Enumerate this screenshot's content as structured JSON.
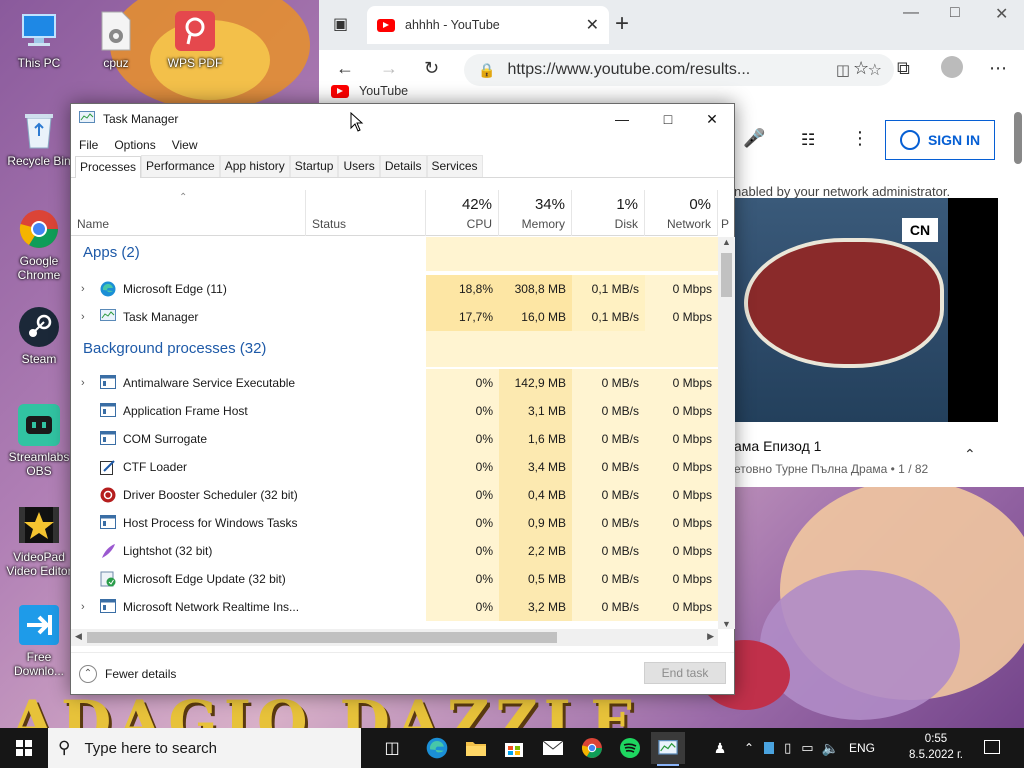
{
  "desktop": {
    "icons": [
      {
        "label": "This PC"
      },
      {
        "label": "cpuz"
      },
      {
        "label": "WPS PDF"
      },
      {
        "label": "Recycle Bin"
      },
      {
        "label": "Google Chrome"
      },
      {
        "label": "Steam"
      },
      {
        "label": "Streamlabs OBS"
      },
      {
        "label": "VideoPad Video Editor"
      },
      {
        "label": "Free Downlo..."
      }
    ],
    "wallpaper_text": "ADAGIO DAZZLE"
  },
  "browser": {
    "tab_title": "ahhhh - YouTube",
    "address": "https://www.youtube.com/results...",
    "favorites_item": "YouTube",
    "sign_in": "SIGN IN",
    "notice_text": "nabled by your network administrator.",
    "channel_logo": "CN",
    "video_title": "ама Епизод 1",
    "video_sub": "етовно Турне Пълна Драма • 1 / 82"
  },
  "task_manager": {
    "title": "Task Manager",
    "menu": [
      "File",
      "Options",
      "View"
    ],
    "tabs": [
      "Processes",
      "Performance",
      "App history",
      "Startup",
      "Users",
      "Details",
      "Services"
    ],
    "active_tab": "Processes",
    "columns": {
      "name": "Name",
      "status": "Status",
      "cpu": {
        "pct": "42%",
        "label": "CPU"
      },
      "memory": {
        "pct": "34%",
        "label": "Memory"
      },
      "disk": {
        "pct": "1%",
        "label": "Disk"
      },
      "network": {
        "pct": "0%",
        "label": "Network"
      },
      "power": "P"
    },
    "groups": {
      "apps": "Apps (2)",
      "background": "Background processes (32)"
    },
    "apps": [
      {
        "name": "Microsoft Edge (11)",
        "cpu": "18,8%",
        "mem": "308,8 MB",
        "disk": "0,1 MB/s",
        "net": "0 Mbps",
        "icon": "edge-icon"
      },
      {
        "name": "Task Manager",
        "cpu": "17,7%",
        "mem": "16,0 MB",
        "disk": "0,1 MB/s",
        "net": "0 Mbps",
        "icon": "taskmanager-icon"
      }
    ],
    "background": [
      {
        "name": "Antimalware Service Executable",
        "cpu": "0%",
        "mem": "142,9 MB",
        "disk": "0 MB/s",
        "net": "0 Mbps",
        "expand": true
      },
      {
        "name": "Application Frame Host",
        "cpu": "0%",
        "mem": "3,1 MB",
        "disk": "0 MB/s",
        "net": "0 Mbps",
        "expand": false
      },
      {
        "name": "COM Surrogate",
        "cpu": "0%",
        "mem": "1,6 MB",
        "disk": "0 MB/s",
        "net": "0 Mbps",
        "expand": false
      },
      {
        "name": "CTF Loader",
        "cpu": "0%",
        "mem": "3,4 MB",
        "disk": "0 MB/s",
        "net": "0 Mbps",
        "expand": false
      },
      {
        "name": "Driver Booster Scheduler (32 bit)",
        "cpu": "0%",
        "mem": "0,4 MB",
        "disk": "0 MB/s",
        "net": "0 Mbps",
        "expand": false
      },
      {
        "name": "Host Process for Windows Tasks",
        "cpu": "0%",
        "mem": "0,9 MB",
        "disk": "0 MB/s",
        "net": "0 Mbps",
        "expand": false
      },
      {
        "name": "Lightshot (32 bit)",
        "cpu": "0%",
        "mem": "2,2 MB",
        "disk": "0 MB/s",
        "net": "0 Mbps",
        "expand": false
      },
      {
        "name": "Microsoft Edge Update (32 bit)",
        "cpu": "0%",
        "mem": "0,5 MB",
        "disk": "0 MB/s",
        "net": "0 Mbps",
        "expand": false
      },
      {
        "name": "Microsoft Network Realtime Ins...",
        "cpu": "0%",
        "mem": "3,2 MB",
        "disk": "0 MB/s",
        "net": "0 Mbps",
        "expand": true
      }
    ],
    "fewer_details": "Fewer details",
    "end_task": "End task"
  },
  "taskbar": {
    "search_placeholder": "Type here to search",
    "language": "ENG",
    "time": "0:55",
    "date": "8.5.2022 г."
  }
}
